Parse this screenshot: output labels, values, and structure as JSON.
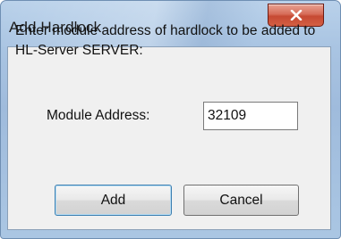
{
  "window": {
    "title": "Add Hardlock",
    "close_icon": "close-icon"
  },
  "dialog": {
    "message": "Enter module address of hardlock to be added to HL-Server SERVER:",
    "address_label": "Module Address:",
    "address_value": "32109"
  },
  "buttons": {
    "add_label": "Add",
    "cancel_label": "Cancel"
  },
  "colors": {
    "close_button": "#c64a33",
    "frame": "#a9c4e2",
    "client_bg": "#f0f0f0",
    "default_button_border": "#3c7fb1"
  }
}
